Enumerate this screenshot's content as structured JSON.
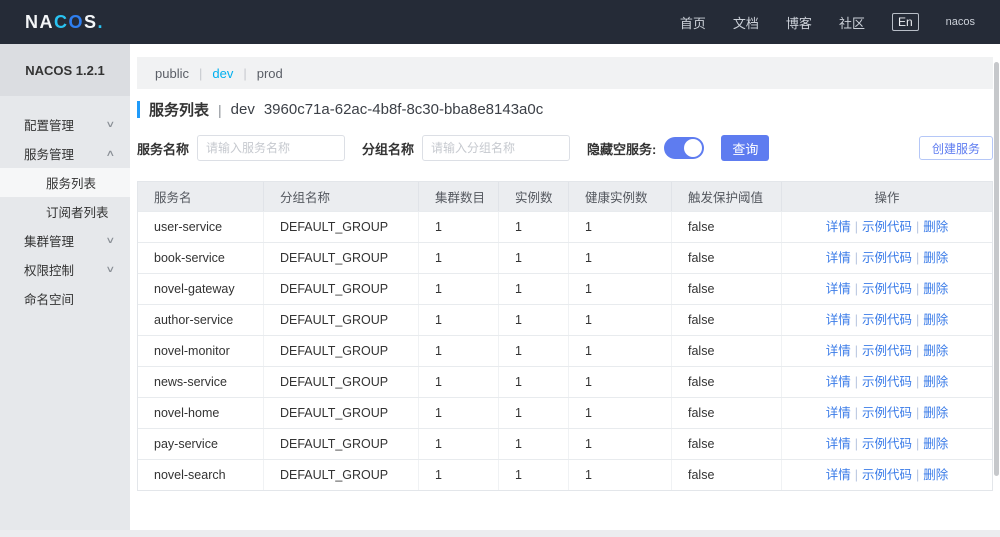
{
  "colors": {
    "topnav_bg": "#252b37",
    "accent_bar": "#209bfa",
    "primary_button": "#5e7cf0",
    "table_link": "#3b7ce8",
    "active_namespace": "#00b0ef"
  },
  "icons": {
    "chevron_down": "∨",
    "chevron_up": "∧"
  },
  "topnav": {
    "logo_na": "NA",
    "logo_c": "C",
    "logo_o": "O",
    "logo_s": "S",
    "logo_dot": ".",
    "items": [
      "首页",
      "文档",
      "博客",
      "社区"
    ],
    "lang": "En",
    "user": "nacos"
  },
  "sidebar": {
    "version": "NACOS 1.2.1",
    "items": [
      {
        "label": "配置管理",
        "chevron": "∨"
      },
      {
        "label": "服务管理",
        "chevron": "∧"
      },
      {
        "label": "服务列表"
      },
      {
        "label": "订阅者列表"
      },
      {
        "label": "集群管理",
        "chevron": "∨"
      },
      {
        "label": "权限控制",
        "chevron": "∨"
      },
      {
        "label": "命名空间"
      }
    ]
  },
  "namespaces": {
    "tabs": [
      "public",
      "dev",
      "prod"
    ],
    "separator": "|",
    "active": "dev"
  },
  "page": {
    "title": "服务列表",
    "pipe": "|",
    "namespace": "dev",
    "namespace_id": "3960c71a-62ac-4b8f-8c30-bba8e8143a0c"
  },
  "filters": {
    "service_name_label": "服务名称",
    "service_name_placeholder": "请输入服务名称",
    "service_name_value": "",
    "group_name_label": "分组名称",
    "group_name_placeholder": "请输入分组名称",
    "group_name_value": "",
    "hide_empty_label": "隐藏空服务:",
    "hide_empty_on": true,
    "query_button": "查询",
    "create_button": "创建服务"
  },
  "table": {
    "headers": [
      "服务名",
      "分组名称",
      "集群数目",
      "实例数",
      "健康实例数",
      "触发保护阈值",
      "操作"
    ],
    "actions": [
      "详情",
      "示例代码",
      "删除"
    ],
    "action_separator": "|",
    "rows": [
      {
        "name": "user-service",
        "group": "DEFAULT_GROUP",
        "clusters": "1",
        "instances": "1",
        "healthy": "1",
        "threshold": "false"
      },
      {
        "name": "book-service",
        "group": "DEFAULT_GROUP",
        "clusters": "1",
        "instances": "1",
        "healthy": "1",
        "threshold": "false"
      },
      {
        "name": "novel-gateway",
        "group": "DEFAULT_GROUP",
        "clusters": "1",
        "instances": "1",
        "healthy": "1",
        "threshold": "false"
      },
      {
        "name": "author-service",
        "group": "DEFAULT_GROUP",
        "clusters": "1",
        "instances": "1",
        "healthy": "1",
        "threshold": "false"
      },
      {
        "name": "novel-monitor",
        "group": "DEFAULT_GROUP",
        "clusters": "1",
        "instances": "1",
        "healthy": "1",
        "threshold": "false"
      },
      {
        "name": "news-service",
        "group": "DEFAULT_GROUP",
        "clusters": "1",
        "instances": "1",
        "healthy": "1",
        "threshold": "false"
      },
      {
        "name": "novel-home",
        "group": "DEFAULT_GROUP",
        "clusters": "1",
        "instances": "1",
        "healthy": "1",
        "threshold": "false"
      },
      {
        "name": "pay-service",
        "group": "DEFAULT_GROUP",
        "clusters": "1",
        "instances": "1",
        "healthy": "1",
        "threshold": "false"
      },
      {
        "name": "novel-search",
        "group": "DEFAULT_GROUP",
        "clusters": "1",
        "instances": "1",
        "healthy": "1",
        "threshold": "false"
      }
    ]
  }
}
